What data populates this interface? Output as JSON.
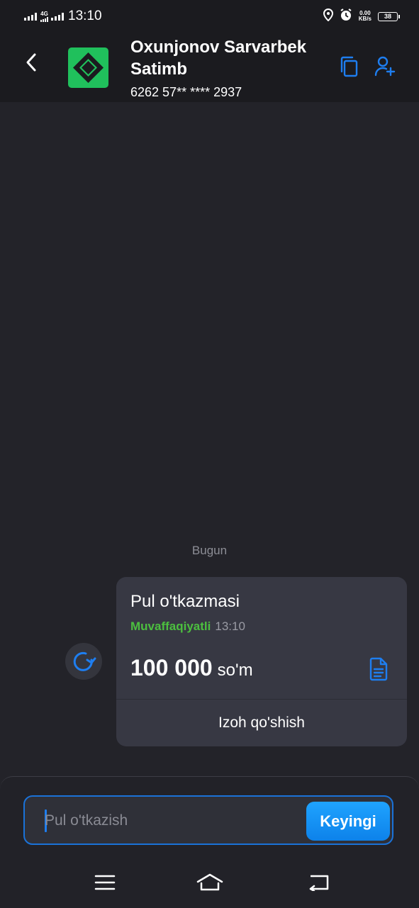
{
  "status_bar": {
    "network": "4G",
    "time": "13:10",
    "speed_value": "0.00",
    "speed_unit": "KB/s",
    "battery": "38"
  },
  "header": {
    "contact_name": "Oxunjonov Sarvarbek Satimb",
    "card_number": "6262 57** **** 2937",
    "back_icon": "chevron-left-icon",
    "copy_icon": "copy-icon",
    "add_contact_icon": "user-plus-icon"
  },
  "chat": {
    "date_label": "Bugun",
    "retry_icon": "refresh-icon",
    "transfer": {
      "title": "Pul o'tkazmasi",
      "status": "Muvaffaqiyatli",
      "time": "13:10",
      "amount": "100 000",
      "currency": "so'm",
      "receipt_icon": "document-icon",
      "comment_label": "Izoh qo'shish"
    }
  },
  "composer": {
    "placeholder": "Pul o'tkazish",
    "value": "",
    "next_label": "Keyingi"
  },
  "navbar": {
    "icons": [
      "menu-icon",
      "home-icon",
      "back-icon"
    ]
  },
  "colors": {
    "background": "#232329",
    "header": "#1b1b1f",
    "bubble": "#373843",
    "accent": "#1e7ef0",
    "success": "#4cbf3f",
    "logo_green": "#20c05c"
  }
}
